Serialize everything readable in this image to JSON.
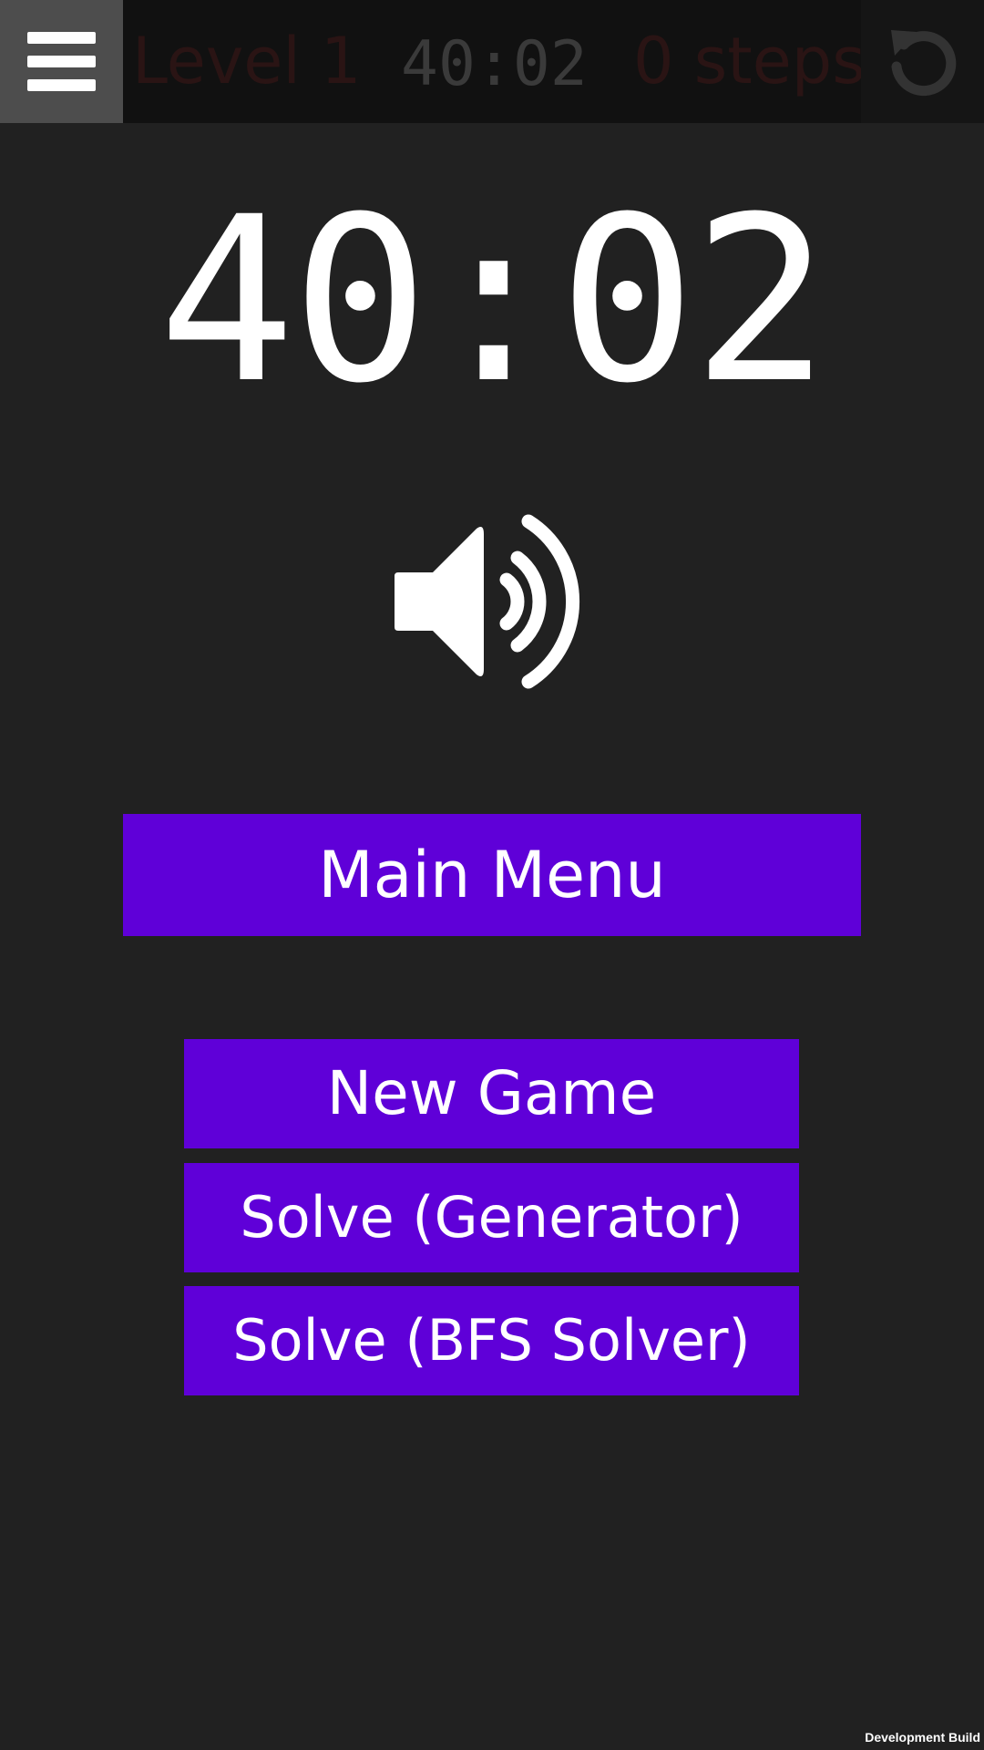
{
  "header": {
    "level": "Level 1",
    "timer": "40:02",
    "steps": "0 steps"
  },
  "icons": {
    "menu": "hamburger-menu-icon",
    "restart": "restart-icon",
    "sound": "speaker-volume-icon"
  },
  "main": {
    "timer": "40:02"
  },
  "buttons": {
    "main_menu": "Main Menu",
    "new_game": "New Game",
    "solve_generator": "Solve (Generator)",
    "solve_bfs": "Solve (BFS Solver)"
  },
  "footer": {
    "build_label": "Development Build"
  },
  "colors": {
    "background": "#212121",
    "topbar": "#111111",
    "button": "#5f00d8",
    "text": "#ffffff"
  }
}
